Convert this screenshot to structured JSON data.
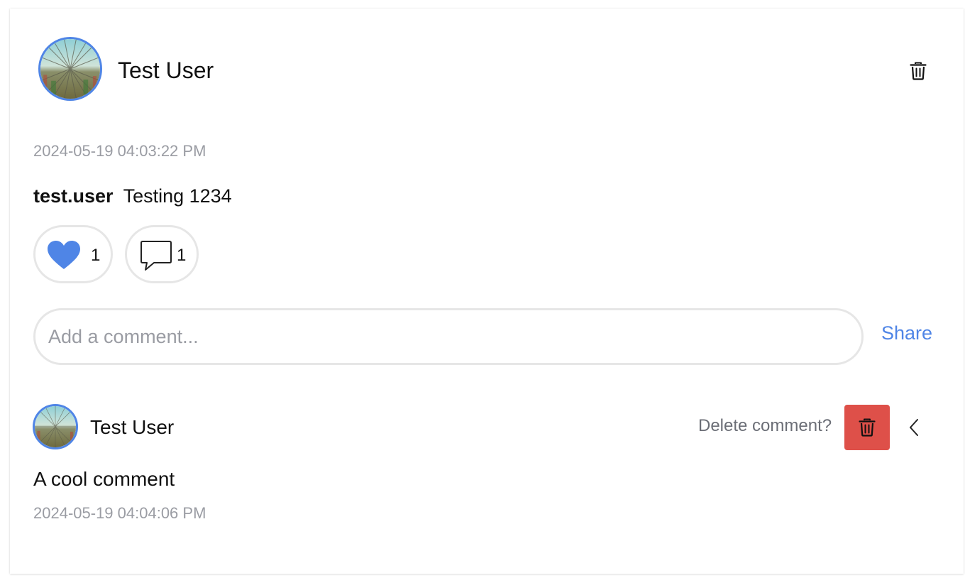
{
  "post": {
    "author_name": "Test User",
    "timestamp": "2024-05-19 04:03:22 PM",
    "username": "test.user",
    "caption": "Testing 1234",
    "likes": "1",
    "comments_count": "1",
    "liked": true
  },
  "comment_form": {
    "placeholder": "Add a comment...",
    "value": "",
    "share_label": "Share"
  },
  "comment": {
    "author_name": "Test User",
    "text": "A cool comment",
    "timestamp": "2024-05-19 04:04:06 PM",
    "delete_prompt": "Delete comment?"
  },
  "icons": {
    "post_delete": "trash-icon",
    "like": "heart-icon",
    "comment": "speech-bubble-icon",
    "confirm_delete": "trash-icon",
    "cancel": "chevron-left-icon"
  },
  "colors": {
    "accent": "#4f85e6",
    "danger": "#de5049",
    "muted_text": "#9a9ca3",
    "pill_border": "#e6e6e6"
  }
}
